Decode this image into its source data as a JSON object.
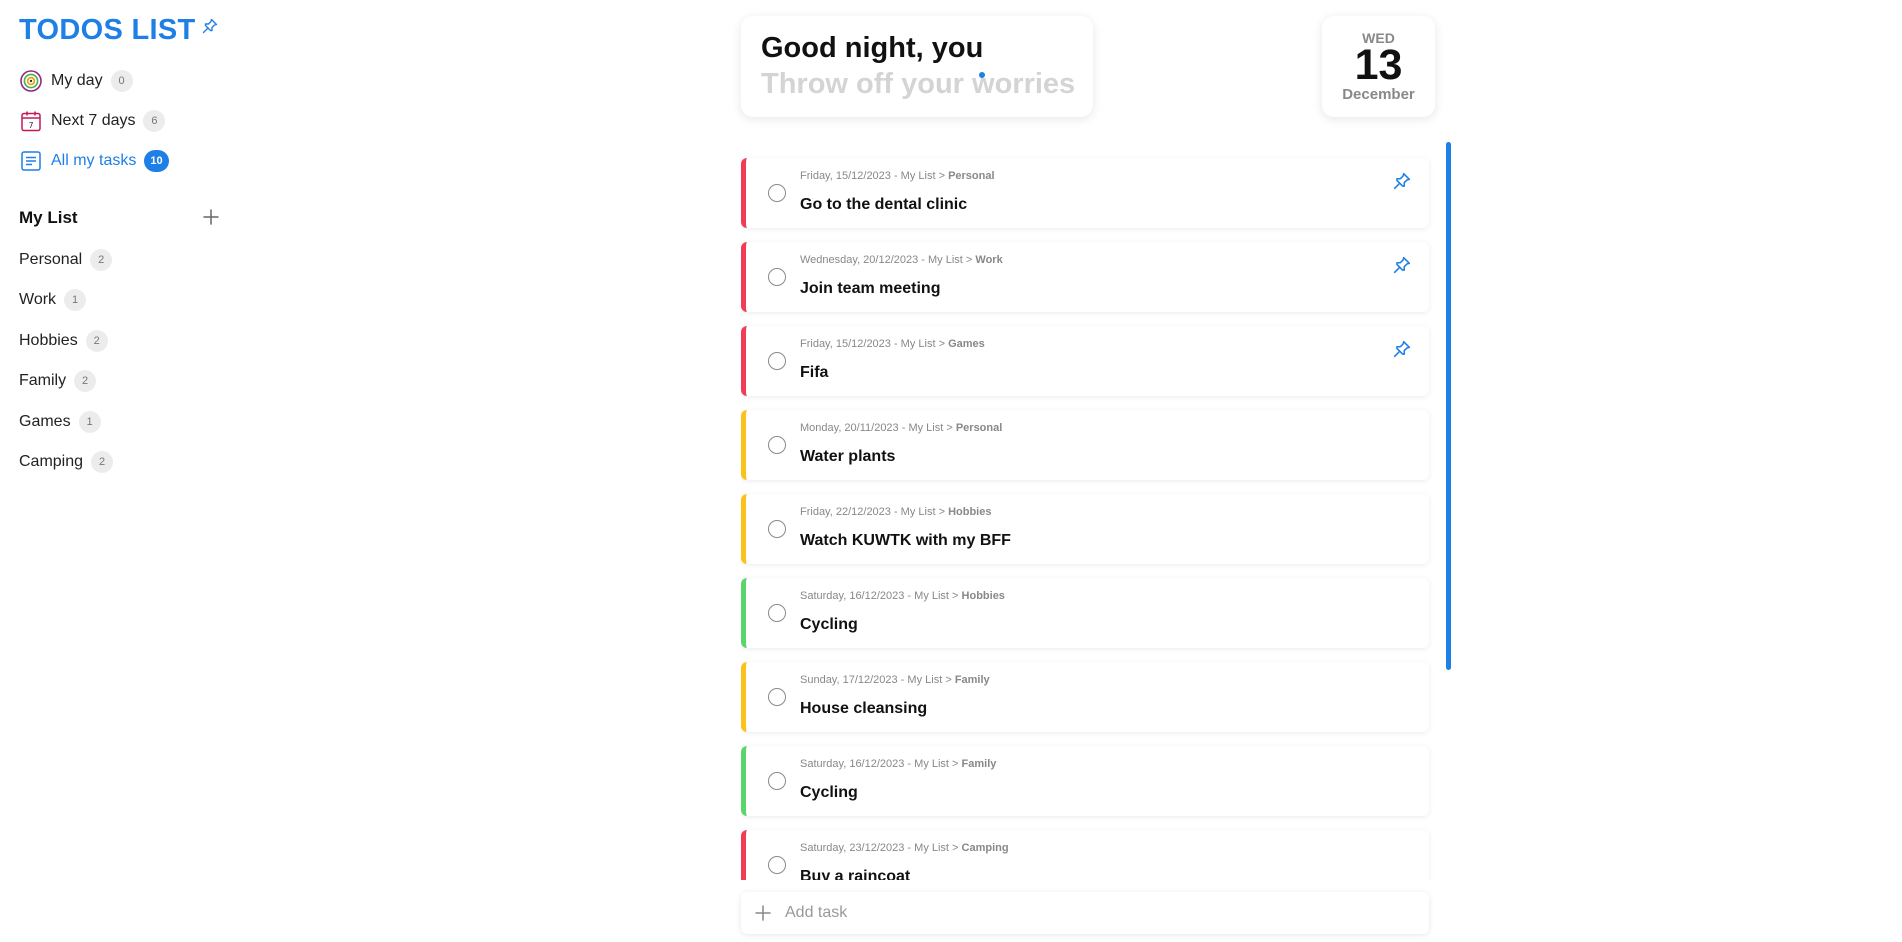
{
  "app": {
    "title": "TODOS LIST"
  },
  "nav": [
    {
      "label": "My day",
      "count": "0",
      "icon": "target-icon",
      "active": false
    },
    {
      "label": "Next 7 days",
      "count": "6",
      "icon": "calendar-icon",
      "active": false
    },
    {
      "label": "All my tasks",
      "count": "10",
      "icon": "list-icon",
      "active": true
    }
  ],
  "lists": {
    "heading": "My List",
    "items": [
      {
        "label": "Personal",
        "count": "2"
      },
      {
        "label": "Work",
        "count": "1"
      },
      {
        "label": "Hobbies",
        "count": "2"
      },
      {
        "label": "Family",
        "count": "2"
      },
      {
        "label": "Games",
        "count": "1"
      },
      {
        "label": "Camping",
        "count": "2"
      }
    ]
  },
  "greeting": {
    "title": "Good night, you",
    "subtitle": "Throw off your worries"
  },
  "date": {
    "weekday": "WED",
    "day": "13",
    "month": "December"
  },
  "tasks": [
    {
      "date": "Friday, 15/12/2023 - My List > ",
      "category": "Personal",
      "title": "Go to the dental clinic",
      "priority": "red",
      "pinned": true
    },
    {
      "date": "Wednesday, 20/12/2023 - My List > ",
      "category": "Work",
      "title": "Join team meeting",
      "priority": "red",
      "pinned": true
    },
    {
      "date": "Friday, 15/12/2023 - My List > ",
      "category": "Games",
      "title": "Fifa",
      "priority": "red",
      "pinned": true
    },
    {
      "date": "Monday, 20/11/2023 - My List > ",
      "category": "Personal",
      "title": "Water plants",
      "priority": "yellow",
      "pinned": false
    },
    {
      "date": "Friday, 22/12/2023 - My List > ",
      "category": "Hobbies",
      "title": "Watch KUWTK with my BFF",
      "priority": "yellow",
      "pinned": false
    },
    {
      "date": "Saturday, 16/12/2023 - My List > ",
      "category": "Hobbies",
      "title": "Cycling",
      "priority": "green",
      "pinned": false
    },
    {
      "date": "Sunday, 17/12/2023 - My List > ",
      "category": "Family",
      "title": "House cleansing",
      "priority": "yellow",
      "pinned": false
    },
    {
      "date": "Saturday, 16/12/2023 - My List > ",
      "category": "Family",
      "title": "Cycling",
      "priority": "green",
      "pinned": false
    },
    {
      "date": "Saturday, 23/12/2023 - My List > ",
      "category": "Camping",
      "title": "Buy a raincoat",
      "priority": "red",
      "pinned": false
    }
  ],
  "add_task": {
    "label": "Add task"
  },
  "colors": {
    "accent": "#1e7fe6",
    "red": "#f03d55",
    "yellow": "#fcc21b",
    "green": "#59d66b"
  }
}
